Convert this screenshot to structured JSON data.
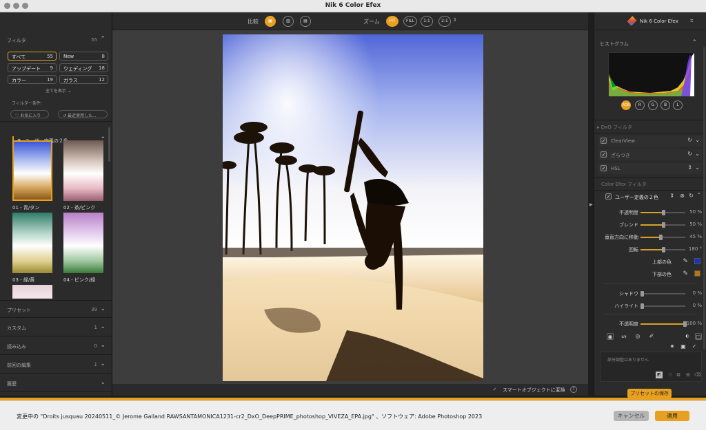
{
  "window": {
    "title": "Nik 6 Color Efex"
  },
  "filters_panel": {
    "title": "フィルタ",
    "count": "55",
    "buttons": [
      {
        "label": "すべて",
        "count": "55",
        "selected": true
      },
      {
        "label": "New",
        "count": "8"
      },
      {
        "label": "アップデート",
        "count": "9"
      },
      {
        "label": "ウェディング",
        "count": "18"
      },
      {
        "label": "カラー",
        "count": "19"
      },
      {
        "label": "ガラス",
        "count": "12"
      }
    ],
    "show_all": "全てを表示",
    "conditions_label": "フィルター条件:",
    "favorites": "お気に入り",
    "recent": "最近使用した...",
    "group_title": "ユーザー定義の２色",
    "thumbnails": [
      {
        "label": "01 - 青/タン"
      },
      {
        "label": "02 - 茶/ピンク"
      },
      {
        "label": "03 - 緑/黄"
      },
      {
        "label": "04 - ピンク/緑"
      }
    ],
    "sections": [
      {
        "label": "プリセット",
        "count": "39"
      },
      {
        "label": "カスタム",
        "count": "1"
      },
      {
        "label": "読み込み",
        "count": "0"
      },
      {
        "label": "前回の編集",
        "count": "1"
      },
      {
        "label": "履歴",
        "count": ""
      }
    ]
  },
  "toolbar": {
    "compare_label": "比較",
    "zoom_label": "ズーム",
    "zoom_buttons": [
      "FIT",
      "FILL",
      "1:1",
      "2:1"
    ]
  },
  "bottom_bar": {
    "smart_object": "スマートオブジェクトに変換"
  },
  "right_panel": {
    "app_name": "Nik 6 Color Efex",
    "histogram_title": "ヒストグラム",
    "histogram_channels": [
      "RGB",
      "R",
      "G",
      "B",
      "L"
    ],
    "dxo_filters_title": "DxO フィルタ",
    "dxo_filters": [
      {
        "label": "ClearView"
      },
      {
        "label": "ざらつき"
      },
      {
        "label": "HSL"
      }
    ],
    "color_efex_title": "Color Efex フィルタ",
    "active_filter": "ユーザー定義の２色",
    "sliders": [
      {
        "label": "不透明度",
        "value": 50,
        "display": "50 %"
      },
      {
        "label": "ブレンド",
        "value": 50,
        "display": "50 %"
      },
      {
        "label": "垂直方向に移動",
        "value": 45,
        "display": "45 %"
      },
      {
        "label": "回転",
        "value": 180,
        "max": 360,
        "display": "180 °"
      }
    ],
    "top_color_label": "上部の色",
    "bottom_color_label": "下部の色",
    "top_color": "#1a2fd0",
    "bottom_color": "#b8760e",
    "shadow_label": "シャドウ",
    "shadow_display": "0 %",
    "highlight_label": "ハイライト",
    "highlight_display": "0 %",
    "opacity_label": "不透明度",
    "opacity_display": "100 %",
    "no_local": "部分調整はありません",
    "save_preset": "プリセットの保存"
  },
  "footer": {
    "message": "変更中の \"Droits jusquau 20240511_© Jerome Galland RAWSANTAMONICA1231-cr2_DxO_DeepPRIME_photoshop_VIVEZA_EPA.jpg\" 、ソフトウェア: Adobe Photoshop 2023",
    "cancel": "キャンセル",
    "apply": "適用"
  },
  "colors": {
    "accent": "#e8a020"
  }
}
